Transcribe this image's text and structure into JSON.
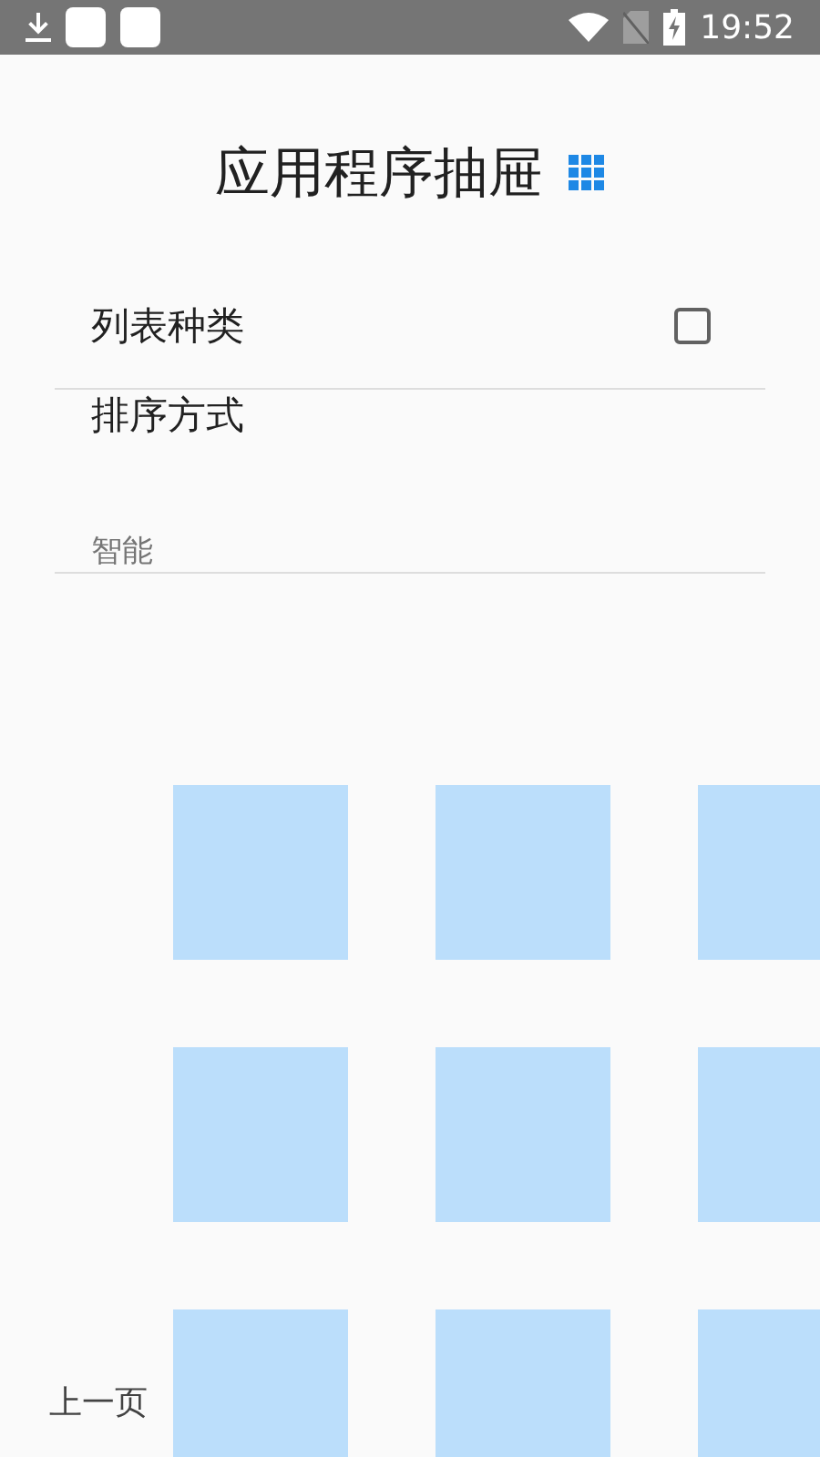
{
  "status_bar": {
    "time": "19:52"
  },
  "title": "应用程序抽屉",
  "settings": [
    {
      "kind": "checkbox",
      "label": "列表种类",
      "checked": false
    },
    {
      "kind": "value",
      "label": "排序方式",
      "value": "智能"
    }
  ],
  "footer": {
    "previous": "上一页"
  }
}
